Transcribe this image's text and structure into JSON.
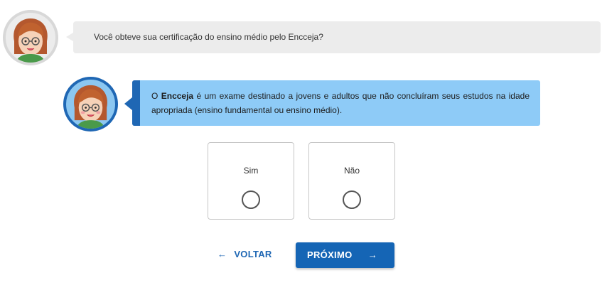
{
  "question": {
    "text": "Você obteve sua certificação do ensino médio pelo Encceja?"
  },
  "info": {
    "prefix": "O ",
    "highlight": "Encceja",
    "suffix": " é um exame destinado a jovens e adultos que não concluíram seus estudos na idade apropriada (ensino fundamental ou ensino médio)."
  },
  "options": [
    {
      "label": "Sim",
      "selected": false
    },
    {
      "label": "Não",
      "selected": false
    }
  ],
  "nav": {
    "back_label": "VOLTAR",
    "back_icon": "arrow-left-icon",
    "next_label": "PRÓXIMO",
    "next_icon": "arrow-right-icon"
  },
  "colors": {
    "primary": "#1565b5",
    "info_bg": "#8ecbf7",
    "question_bg": "#ececec"
  }
}
